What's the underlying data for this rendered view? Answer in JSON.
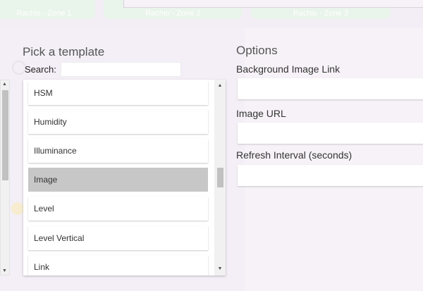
{
  "background": {
    "tiles": [
      {
        "label": "Rachio - Zone 1"
      },
      {
        "label": "Rachio - Zone 2"
      },
      {
        "label": "Rachio - Zone 3"
      }
    ]
  },
  "template_picker": {
    "title": "Pick a template",
    "search_label": "Search:",
    "search_value": "",
    "items": [
      {
        "label": "HSM"
      },
      {
        "label": "Humidity"
      },
      {
        "label": "Illuminance"
      },
      {
        "label": "Image",
        "selected": true
      },
      {
        "label": "Level"
      },
      {
        "label": "Level Vertical"
      },
      {
        "label": "Link"
      }
    ],
    "scrollbar": {
      "up_icon": "triangle-up",
      "down_icon": "triangle-down",
      "scroll_position": 0.5
    }
  },
  "options": {
    "title": "Options",
    "fields": [
      {
        "label": "Background Image Link",
        "value": ""
      },
      {
        "label": "Image URL",
        "value": ""
      },
      {
        "label": "Refresh Interval (seconds)",
        "value": ""
      }
    ]
  },
  "colors": {
    "selected_item": "#c7c7c7",
    "tile_bg": "#e9f4ea",
    "page_bg": "#f3eef5"
  }
}
